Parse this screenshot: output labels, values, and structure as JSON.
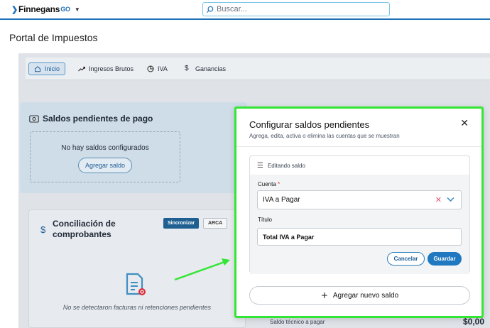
{
  "header": {
    "logo_text": "Finnegans",
    "logo_suffix": "GO",
    "search_placeholder": "Buscar..."
  },
  "page_title": "Portal de Impuestos",
  "tabs": [
    {
      "label": "Inicio",
      "icon": "home-icon",
      "active": true
    },
    {
      "label": "Ingresos Brutos",
      "icon": "trending-up-icon",
      "active": false
    },
    {
      "label": "IVA",
      "icon": "pie-chart-icon",
      "active": false
    },
    {
      "label": "Ganancias",
      "icon": "dollar-icon",
      "active": false
    }
  ],
  "saldos_card": {
    "title": "Saldos pendientes de pago",
    "empty_message": "No hay saldos configurados",
    "add_button": "Agregar saldo"
  },
  "conciliacion_card": {
    "title": "Conciliación de comprobantes",
    "sync_button": "Sincronizar",
    "arca_button": "ARCA",
    "empty_message": "No se detectaron facturas ni retenciones pendientes"
  },
  "bottom_row": {
    "label": "Saldo técnico a pagar",
    "value": "$0,00"
  },
  "modal": {
    "title": "Configurar saldos pendientes",
    "subtitle": "Agrega, edita, activa o elimina las cuentas que se muestran",
    "editing_header": "Editando saldo",
    "cuenta_label": "Cuenta",
    "cuenta_required": "*",
    "cuenta_value": "IVA a Pagar",
    "titulo_label": "Título",
    "titulo_value": "Total IVA a Pagar",
    "cancel_button": "Cancelar",
    "save_button": "Guardar",
    "add_new_button": "Agregar nuevo saldo"
  },
  "colors": {
    "brand": "#1d6fb8",
    "highlight": "#34e634",
    "primary_button": "#1f78c0"
  }
}
